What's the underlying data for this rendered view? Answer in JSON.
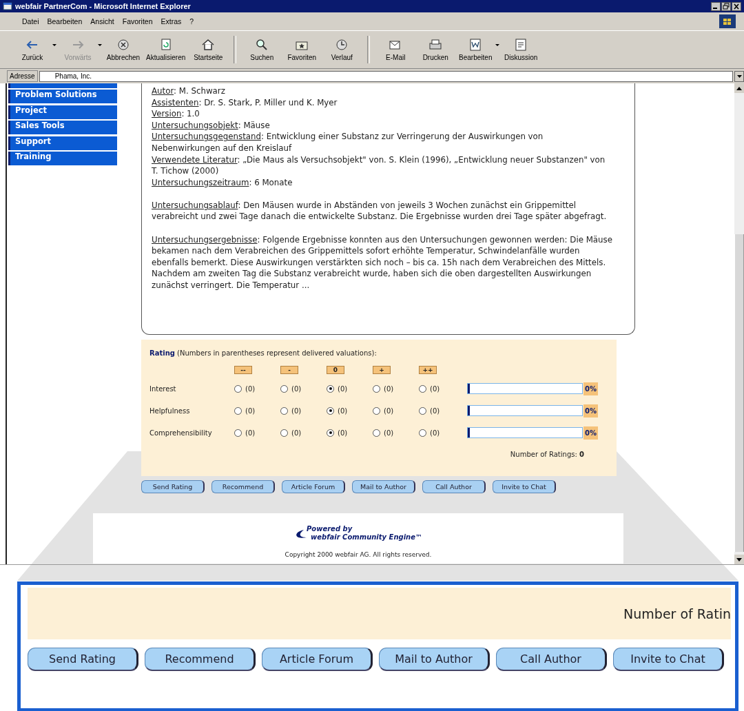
{
  "window": {
    "title": "webfair PartnerCom - Microsoft Internet Explorer"
  },
  "menu": [
    "Datei",
    "Bearbeiten",
    "Ansicht",
    "Favoriten",
    "Extras",
    "?"
  ],
  "toolbar": [
    {
      "kind": "back",
      "label": "Zurück",
      "disabled": false,
      "dropdown": true
    },
    {
      "kind": "forward",
      "label": "Vorwärts",
      "disabled": true,
      "dropdown": true
    },
    {
      "kind": "stop",
      "label": "Abbrechen",
      "disabled": false,
      "dropdown": false
    },
    {
      "kind": "refresh",
      "label": "Aktualisieren",
      "disabled": false,
      "dropdown": false
    },
    {
      "kind": "home",
      "label": "Startseite",
      "disabled": false,
      "dropdown": false
    },
    {
      "kind": "search",
      "label": "Suchen",
      "disabled": false,
      "dropdown": false
    },
    {
      "kind": "favorites",
      "label": "Favoriten",
      "disabled": false,
      "dropdown": false
    },
    {
      "kind": "history",
      "label": "Verlauf",
      "disabled": false,
      "dropdown": false
    },
    {
      "kind": "mail",
      "label": "E-Mail",
      "disabled": false,
      "dropdown": false
    },
    {
      "kind": "print",
      "label": "Drucken",
      "disabled": false,
      "dropdown": false
    },
    {
      "kind": "edit",
      "label": "Bearbeiten",
      "disabled": false,
      "dropdown": true
    },
    {
      "kind": "discuss",
      "label": "Diskussion",
      "disabled": false,
      "dropdown": false
    }
  ],
  "address": {
    "label": "Adresse",
    "value": "Phama, Inc."
  },
  "sidebar": {
    "items": [
      {
        "label": "Problem Solutions"
      },
      {
        "label": "Project"
      },
      {
        "label": "Sales Tools"
      },
      {
        "label": "Support"
      },
      {
        "label": "Training"
      }
    ]
  },
  "article": {
    "sections": [
      [
        {
          "label": "Autor",
          "value": ": M. Schwarz"
        },
        {
          "label": "Assistenten",
          "value": ": Dr. S. Stark, P. Miller und K. Myer"
        },
        {
          "label": "Version",
          "value": ": 1.0"
        },
        {
          "label": "Untersuchungsobjekt",
          "value": ": Mäuse"
        },
        {
          "label": "Untersuchungsgegenstand",
          "value": ": Entwicklung einer Substanz zur Verringerung der Auswirkungen von Nebenwirkungen auf den Kreislauf"
        },
        {
          "label": "Verwendete Literatur",
          "value": ": „Die Maus als Versuchsobjekt\" von. S. Klein (1996), „Entwicklung neuer Substanzen\" von T. Tichow (2000)"
        },
        {
          "label": "Untersuchungszeitraum",
          "value": ": 6 Monate"
        }
      ],
      [
        {
          "label": "Untersuchungsablauf",
          "value": ": Den Mäusen wurde in Abständen von jeweils 3 Wochen zunächst ein Grippemittel verabreicht und zwei Tage danach die entwickelte Substanz. Die Ergebnisse wurden drei Tage später abgefragt."
        }
      ],
      [
        {
          "label": "Untersuchungsergebnisse",
          "value": ": Folgende Ergebnisse konnten aus den Untersuchungen gewonnen werden: Die Mäuse bekamen nach dem Verabreichen des Grippemittels sofort erhöhte Temperatur, Schwindelanfälle wurden ebenfalls bemerkt. Diese Auswirkungen verstärkten sich noch – bis ca. 15h nach dem Verabreichen des Mittels. Nachdem am zweiten Tag die Substanz verabreicht wurde, haben sich die oben dargestellten Auswirkungen zunächst verringert. Die Temperatur ..."
        }
      ]
    ]
  },
  "rating": {
    "title": "**Rating** (Numbers in parentheses represent delivered valuations):",
    "scale": [
      "--",
      "-",
      "0",
      "+",
      "++"
    ],
    "rows": [
      {
        "label": "Interest",
        "options": [
          {
            "count": "(0)",
            "selected": false
          },
          {
            "count": "(0)",
            "selected": false
          },
          {
            "count": "(0)",
            "selected": true
          },
          {
            "count": "(0)",
            "selected": false
          },
          {
            "count": "(0)",
            "selected": false
          }
        ],
        "level": 0,
        "percent": "0%"
      },
      {
        "label": "Helpfulness",
        "options": [
          {
            "count": "(0)",
            "selected": false
          },
          {
            "count": "(0)",
            "selected": false
          },
          {
            "count": "(0)",
            "selected": true
          },
          {
            "count": "(0)",
            "selected": false
          },
          {
            "count": "(0)",
            "selected": false
          }
        ],
        "level": 0,
        "percent": "0%"
      },
      {
        "label": "Comprehensibility",
        "options": [
          {
            "count": "(0)",
            "selected": false
          },
          {
            "count": "(0)",
            "selected": false
          },
          {
            "count": "(0)",
            "selected": true
          },
          {
            "count": "(0)",
            "selected": false
          },
          {
            "count": "(0)",
            "selected": false
          }
        ],
        "level": 0,
        "percent": "0%"
      }
    ],
    "count_label": "Number of Ratings:",
    "count": "0"
  },
  "actions": [
    "Send Rating",
    "Recommend",
    "Article Forum",
    "Mail to Author",
    "Call Author",
    "Invite to Chat"
  ],
  "footer": {
    "powered_by": "Powered by",
    "engine": "webfair Community Engine™",
    "copyright": "Copyright 2000 webfair AG. All rights reserved."
  },
  "callout": {
    "count_label": "Number of Ratin",
    "buttons": [
      "Send Rating",
      "Recommend",
      "Article Forum",
      "Mail to Author",
      "Call Author",
      "Invite to Chat"
    ]
  }
}
